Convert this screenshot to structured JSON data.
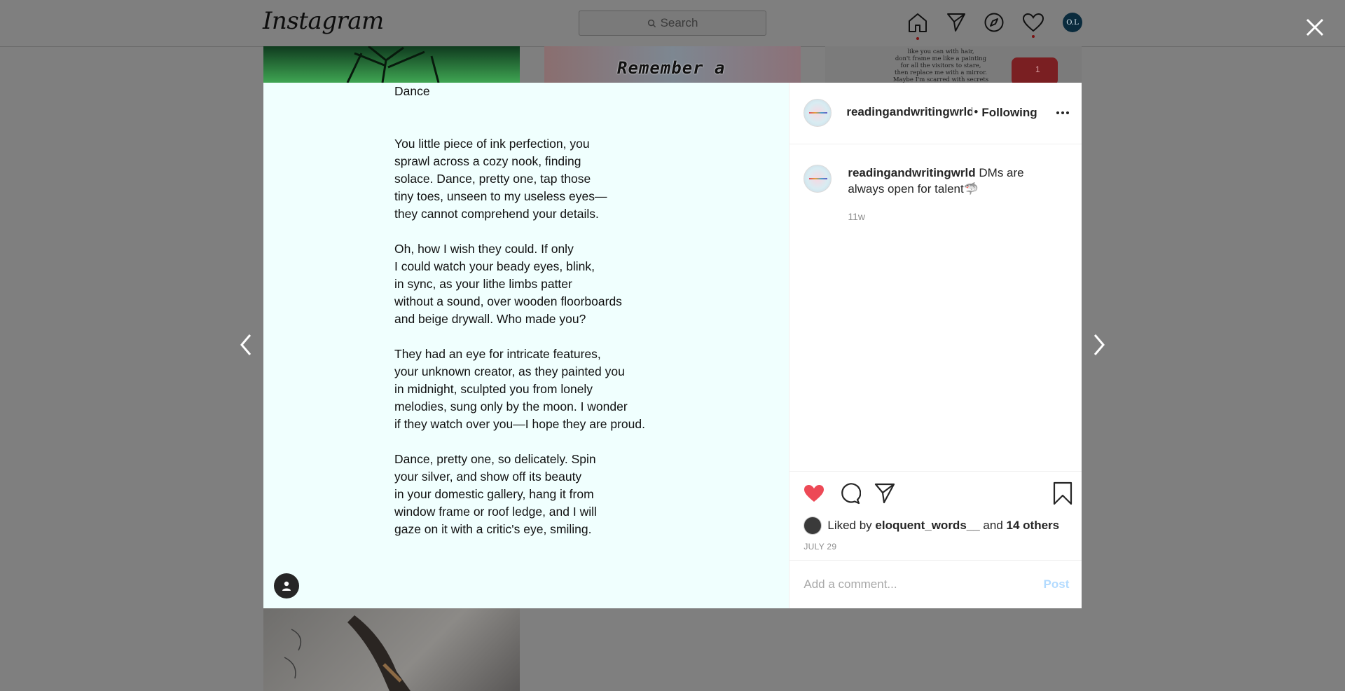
{
  "header": {
    "logo": "Instagram",
    "search_placeholder": "Search",
    "profile_initials": "O.L"
  },
  "background_tiles": {
    "middle_text": "Remember a",
    "right_text": [
      "like you can with hair,",
      "don't frame me like a painting",
      "for all the visitors to stare,",
      "then replace me with a mirror.",
      "Maybe I'm scarred with secrets"
    ],
    "right_badge_count": "1"
  },
  "post": {
    "title": "Dance",
    "stanzas": [
      [
        "You little piece of ink perfection, you",
        "sprawl across a cozy nook, finding",
        "solace. Dance, pretty one, tap those",
        "tiny toes, unseen to my useless eyes—",
        "they cannot comprehend your details."
      ],
      [
        "Oh, how I wish they could. If only",
        "I could watch your beady eyes, blink,",
        "in sync, as your lithe limbs patter",
        "without a sound, over wooden floorboards",
        "and beige drywall. Who made you?"
      ],
      [
        "They had an eye for intricate features,",
        "your unknown creator, as they painted you",
        "in midnight, sculpted you from lonely",
        "melodies, sung only by the moon. I wonder",
        "if they watch over you—I hope they are proud."
      ],
      [
        "Dance, pretty one, so delicately. Spin",
        "your silver, and show off its beauty",
        "in your domestic gallery, hang it from",
        "window frame or roof ledge, and I will",
        "gaze on it with a critic's eye, smiling."
      ]
    ]
  },
  "sidebar": {
    "username": "readingandwritingwrld",
    "separator": "•",
    "follow_status": "Following",
    "caption_user": "readingandwritingwrld",
    "caption_text": " DMs are always open for talent🦈",
    "caption_time": "11w",
    "liked_prefix": "Liked by ",
    "liked_user": "eloquent_words__",
    "liked_and": " and ",
    "liked_others": "14 others",
    "date": "JULY 29",
    "comment_placeholder": "Add a comment...",
    "post_label": "Post"
  },
  "colors": {
    "overlay": "#7f7f7f",
    "post_bg": "#f0fffe",
    "like_red": "#ed4956",
    "post_button": "#b3dbff"
  }
}
